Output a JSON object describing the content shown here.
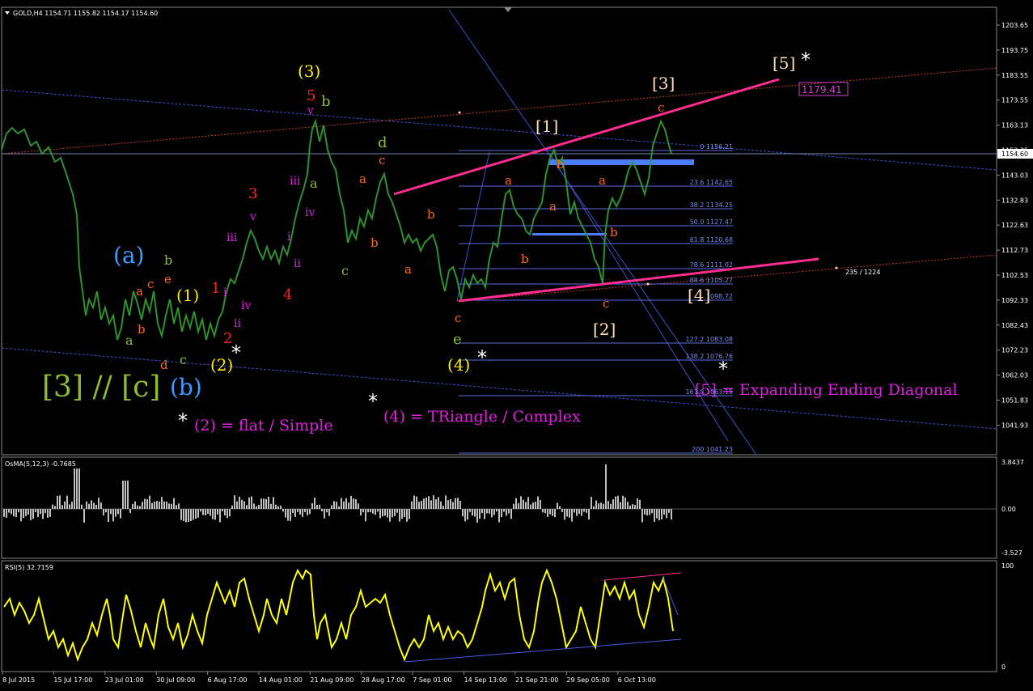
{
  "header": {
    "main_title": "GOLD,H4  1154.71 1155.82 1154.17 1154.60",
    "osma_title": "OsMA(5,12,3) -0.7685",
    "rsi_title": "RSI(5) 32.7159"
  },
  "price_axis": {
    "ticks": [
      "1203.65",
      "1193.75",
      "1183.55",
      "1173.55",
      "1163.13",
      "1153.35",
      "1143.03",
      "1132.83",
      "1122.63",
      "1112.73",
      "1102.53",
      "1092.33",
      "1082.43",
      "1072.23",
      "1062.03",
      "1051.83",
      "1041.93"
    ],
    "current_price": "1154.60"
  },
  "osma_axis": {
    "ticks": [
      "3.8437",
      "0.00",
      "-3.527"
    ]
  },
  "rsi_axis": {
    "ticks": [
      "100",
      "0"
    ]
  },
  "time_axis": {
    "ticks": [
      "8 Jul 2015",
      "15 Jul 17:00",
      "23 Jul 01:00",
      "30 Jul 09:00",
      "6 Aug 17:00",
      "14 Aug 01:00",
      "21 Aug 09:00",
      "28 Aug 17:00",
      "7 Sep 01:00",
      "14 Sep 13:00",
      "21 Sep 21:00",
      "29 Sep 05:00",
      "6 Oct 13:00"
    ]
  },
  "fibo_levels": [
    "0 1156.21",
    "23.6 1142.65",
    "38.2 1134.25",
    "50.0 1127.47",
    "61.8 1120.68",
    "78.6 1111.02",
    "88.6 1105.27",
    "1098.72",
    "127.2 1083.08",
    "138.2 1076.76",
    "161.8 1063.19",
    "200 1041.23"
  ],
  "target_label": "1179.41",
  "trend_label": "235 / 1224",
  "annotations": {
    "a3c": "[3] // [c]",
    "a_paren": "(a)",
    "b_paren": "(b)",
    "w1": "(1)",
    "w2": "(2)",
    "w3": "(3)",
    "w4": "(4)",
    "b1": "[1]",
    "b2": "[2]",
    "b3": "[3]",
    "b4": "[4]",
    "b5": "[5]",
    "star": "*",
    "note2": "(2) = flat / Simple",
    "note4": "(4) = TRiangle / Complex",
    "note5": "[5] = Expanding Ending Diagonal"
  },
  "wave_letters": {
    "a": "a",
    "b": "b",
    "c": "c",
    "d": "d",
    "e": "e",
    "n1": "1",
    "n2": "2",
    "n3": "3",
    "n4": "4",
    "n5": "5",
    "i": "i",
    "ii": "ii",
    "iii": "iii",
    "iv": "iv",
    "v": "v"
  },
  "colors": {
    "background": "#000000",
    "candles": "#3fa53f",
    "fibo": "#5a6de0",
    "diagonal": "#ff2d8f",
    "rsi": "#ffff00",
    "osma": "#c0c0c0",
    "blue_zone": "#4a7dff",
    "orange_label": "#ff6a1a",
    "red_label": "#ff2020",
    "magenta_label": "#e020e0",
    "yellow_label": "#ffee00",
    "green_label": "#8fbc2f",
    "sky_label": "#3b9cff",
    "cream_label": "#ffe0b0"
  }
}
